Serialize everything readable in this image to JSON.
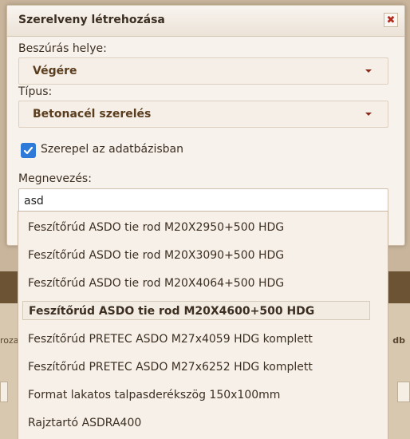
{
  "background": {
    "left_fragment": "rozat",
    "right_fragment": "db"
  },
  "dialog": {
    "title": "Szerelveny létrehozása",
    "close_glyph": "✖",
    "insert_label": "Beszúrás helye:",
    "insert_value": "Végére",
    "type_label": "Típus:",
    "type_value": "Betonacél szerelés",
    "db_checkbox_label": "Szerepel az adatbázisban",
    "db_checkbox_checked": true,
    "name_label": "Megnevezés:",
    "name_value": "asd"
  },
  "autocomplete": {
    "items": [
      "Feszítőrúd ASDO tie rod M20X2950+500 HDG",
      "Feszítőrúd ASDO tie rod M20X3090+500 HDG",
      "Feszítőrúd ASDO tie rod M20X4064+500 HDG",
      "Feszítőrúd ASDO tie rod M20X4600+500 HDG",
      "Feszítőrúd PRETEC ASDO M27x4059 HDG komplett",
      "Feszítőrúd PRETEC ASDO M27x6252 HDG komplett",
      "Format lakatos talpasderékszög 150x100mm",
      "Rajztartó ASDRA400"
    ],
    "active_index": 3
  },
  "colors": {
    "accent_checkbox": "#2d7ad8",
    "caret": "#8a2a1a",
    "close_icon": "#b02a1e"
  },
  "icons": {
    "close": "close-icon",
    "dropdown": "chevron-down-icon",
    "check": "check-icon"
  }
}
